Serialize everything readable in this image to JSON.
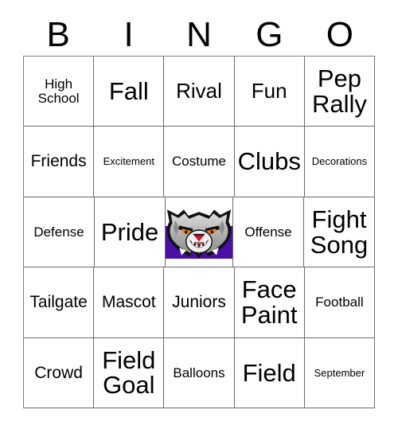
{
  "card": {
    "title": "BINGO",
    "header_letters": [
      "B",
      "I",
      "N",
      "G",
      "O"
    ],
    "grid_size": "5x5",
    "colors": {
      "mascot_band_purple": "#4B0FA5",
      "mascot_fur_gray": "#A8A8A8",
      "mascot_fur_light": "#DCDCDC",
      "mascot_outline": "#111111",
      "mascot_eye_orange": "#E8821E",
      "mascot_nose_red": "#D8102A",
      "grid_line": "#6A6A6A",
      "text": "#000000",
      "background": "#FFFFFF"
    },
    "rows": [
      [
        {
          "text": "High\nSchool",
          "size": "sm"
        },
        {
          "text": "Fall",
          "size": "xl"
        },
        {
          "text": "Rival",
          "size": "lg"
        },
        {
          "text": "Fun",
          "size": "lg"
        },
        {
          "text": "Pep\nRally",
          "size": "xl"
        }
      ],
      [
        {
          "text": "Friends",
          "size": "md"
        },
        {
          "text": "Excitement",
          "size": "xs"
        },
        {
          "text": "Costume",
          "size": "sm"
        },
        {
          "text": "Clubs",
          "size": "xl"
        },
        {
          "text": "Decorations",
          "size": "xs"
        }
      ],
      [
        {
          "text": "Defense",
          "size": "sm"
        },
        {
          "text": "Pride",
          "size": "xl"
        },
        {
          "text": "",
          "size": "md",
          "free_space": true,
          "icon": "wildcat-mascot-icon"
        },
        {
          "text": "Offense",
          "size": "sm"
        },
        {
          "text": "Fight\nSong",
          "size": "xl"
        }
      ],
      [
        {
          "text": "Tailgate",
          "size": "md"
        },
        {
          "text": "Mascot",
          "size": "md"
        },
        {
          "text": "Juniors",
          "size": "md"
        },
        {
          "text": "Face\nPaint",
          "size": "xl"
        },
        {
          "text": "Football",
          "size": "sm"
        }
      ],
      [
        {
          "text": "Crowd",
          "size": "md"
        },
        {
          "text": "Field\nGoal",
          "size": "xl"
        },
        {
          "text": "Balloons",
          "size": "sm"
        },
        {
          "text": "Field",
          "size": "xl"
        },
        {
          "text": "September",
          "size": "xs"
        }
      ]
    ]
  }
}
